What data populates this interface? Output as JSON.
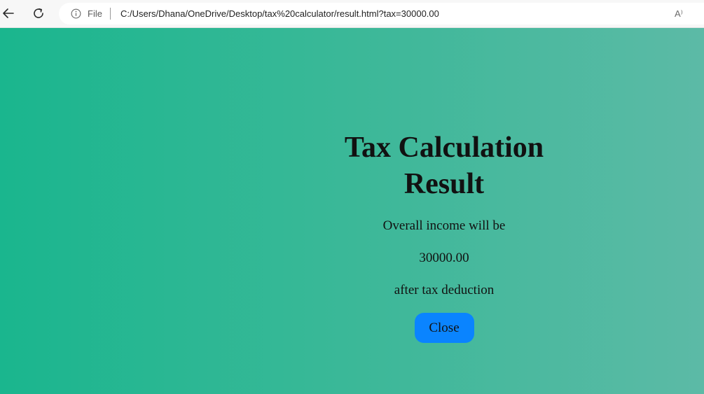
{
  "browser": {
    "file_label": "File",
    "url": "C:/Users/Dhana/OneDrive/Desktop/tax%20calculator/result.html?tax=30000.00",
    "read_aloud_label": "A⁾"
  },
  "result": {
    "title": "Tax Calculation Result",
    "line1": "Overall income will be",
    "amount": "30000.00",
    "line3": "after tax deduction",
    "close_label": "Close"
  },
  "colors": {
    "gradient_start": "#1ab68e",
    "gradient_end": "#5cbaa6",
    "button": "#0a84ff"
  }
}
